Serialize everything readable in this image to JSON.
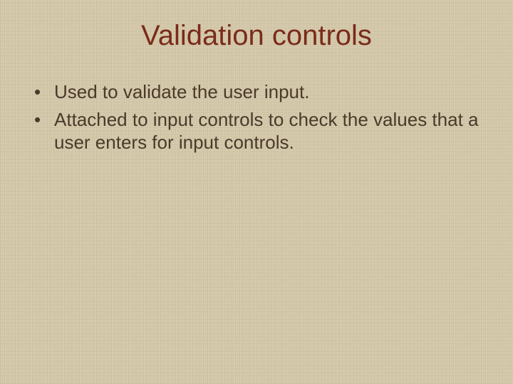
{
  "slide": {
    "title": "Validation controls",
    "bullets": [
      "Used to validate the user input.",
      "Attached to input controls to check the values that a user enters for input controls."
    ]
  }
}
